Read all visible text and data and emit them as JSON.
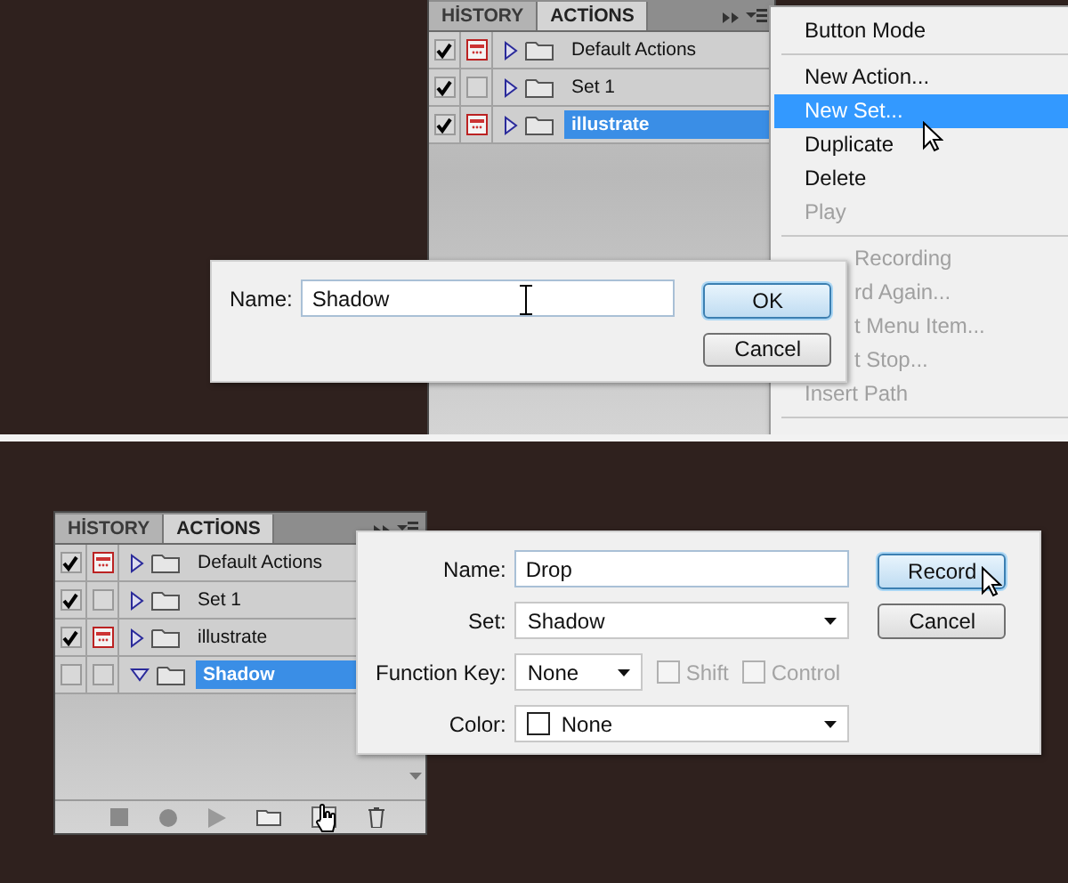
{
  "top": {
    "panel": {
      "tabs": [
        {
          "label": "HİSTORY",
          "selected": false
        },
        {
          "label": "ACTİONS",
          "selected": true
        }
      ],
      "sets": [
        {
          "name": "Default Actions",
          "checked": true,
          "dialog_toggle": true,
          "expanded": false,
          "selected": false
        },
        {
          "name": "Set 1",
          "checked": true,
          "dialog_toggle": false,
          "expanded": false,
          "selected": false
        },
        {
          "name": "illustrate",
          "checked": true,
          "dialog_toggle": true,
          "expanded": false,
          "selected": true
        }
      ]
    },
    "menu": {
      "groups": [
        [
          {
            "label": "Button Mode",
            "kind": "full",
            "selected": false,
            "disabled": false
          }
        ],
        [
          {
            "label": "New Action...",
            "kind": "full",
            "selected": false,
            "disabled": false
          },
          {
            "label": "New Set...",
            "kind": "full",
            "selected": true,
            "disabled": false
          },
          {
            "label": "Duplicate",
            "kind": "full",
            "selected": false,
            "disabled": false
          },
          {
            "label": "Delete",
            "kind": "full",
            "selected": false,
            "disabled": false
          },
          {
            "label": "Play",
            "kind": "full",
            "selected": false,
            "disabled": true
          }
        ],
        [
          {
            "label": "Recording",
            "kind": "covered",
            "selected": false,
            "disabled": true
          },
          {
            "label": "rd Again...",
            "kind": "covered",
            "selected": false,
            "disabled": true
          },
          {
            "label": "t Menu Item...",
            "kind": "covered",
            "selected": false,
            "disabled": true
          },
          {
            "label": "t Stop...",
            "kind": "covered",
            "selected": false,
            "disabled": true
          },
          {
            "label": "Insert Path",
            "kind": "full",
            "selected": false,
            "disabled": true
          }
        ]
      ]
    },
    "dialog": {
      "fields": [
        {
          "kind": "text",
          "label": "Name:",
          "value": "Shadow"
        }
      ],
      "buttons": [
        {
          "label": "OK",
          "default": true
        },
        {
          "label": "Cancel",
          "default": false
        }
      ]
    }
  },
  "bottom": {
    "panel": {
      "tabs": [
        {
          "label": "HİSTORY",
          "selected": false
        },
        {
          "label": "ACTİONS",
          "selected": true
        }
      ],
      "sets": [
        {
          "name": "Default Actions",
          "checked": true,
          "dialog_toggle": true,
          "expanded": false,
          "selected": false
        },
        {
          "name": "Set 1",
          "checked": true,
          "dialog_toggle": false,
          "expanded": false,
          "selected": false
        },
        {
          "name": "illustrate",
          "checked": true,
          "dialog_toggle": true,
          "expanded": false,
          "selected": false
        },
        {
          "name": "Shadow",
          "checked": false,
          "dialog_toggle": false,
          "expanded": true,
          "selected": true
        }
      ],
      "toolbar": true
    },
    "dialog": {
      "fields": [
        {
          "kind": "text",
          "label": "Name:",
          "value": "Drop"
        },
        {
          "kind": "select",
          "label": "Set:",
          "value": "Shadow"
        },
        {
          "kind": "key",
          "label": "Function Key:",
          "value": "None",
          "options": [
            {
              "label": "Shift",
              "checked": false,
              "disabled": true
            },
            {
              "label": "Control",
              "checked": false,
              "disabled": true
            }
          ]
        },
        {
          "kind": "color",
          "label": "Color:",
          "value": "None"
        }
      ],
      "buttons": [
        {
          "label": "Record",
          "default": true
        },
        {
          "label": "Cancel",
          "default": false
        }
      ]
    }
  }
}
